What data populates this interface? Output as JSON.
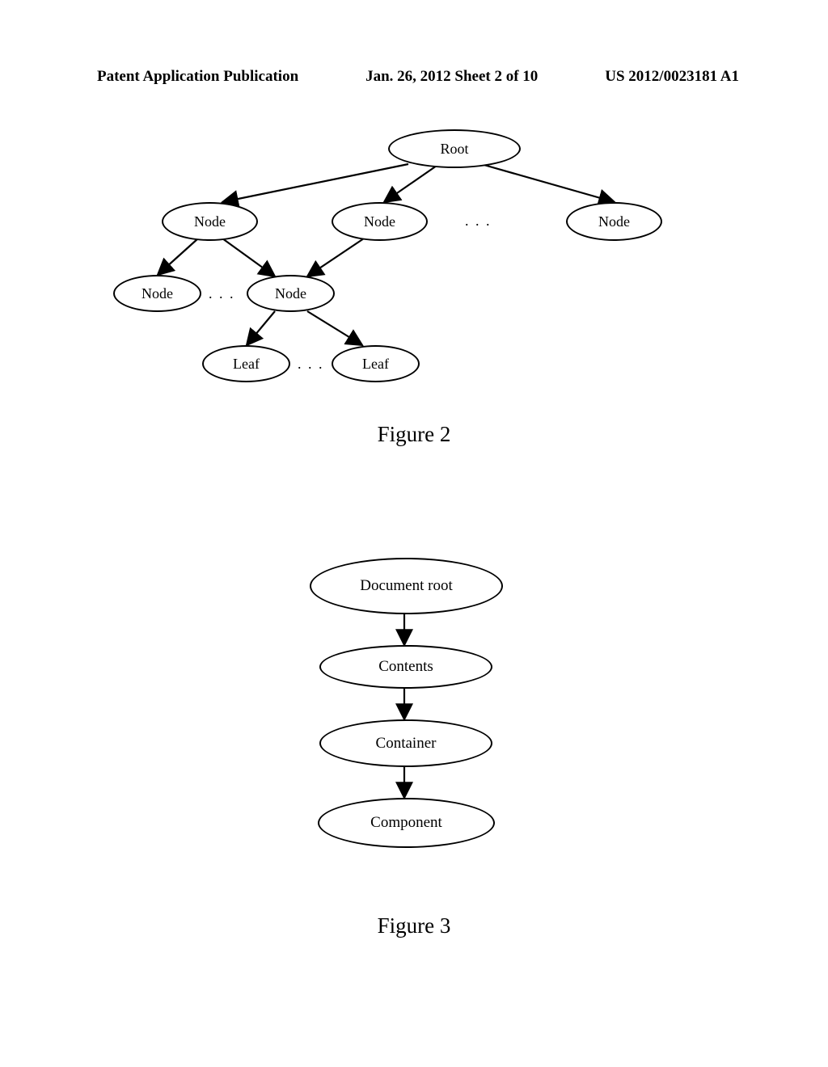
{
  "header": {
    "left": "Patent Application Publication",
    "center": "Jan. 26, 2012  Sheet 2 of 10",
    "right": "US 2012/0023181 A1"
  },
  "figure2": {
    "label": "Figure 2",
    "nodes": {
      "root": "Root",
      "l1a": "Node",
      "l1b": "Node",
      "l1c": "Node",
      "l2a": "Node",
      "l2b": "Node",
      "l3a": "Leaf",
      "l3b": "Leaf"
    },
    "dots": {
      "d1": ". . .",
      "d2": ". . .",
      "d3": ". . ."
    }
  },
  "figure3": {
    "label": "Figure 3",
    "nodes": {
      "n1": "Document root",
      "n2": "Contents",
      "n3": "Container",
      "n4": "Component"
    }
  }
}
